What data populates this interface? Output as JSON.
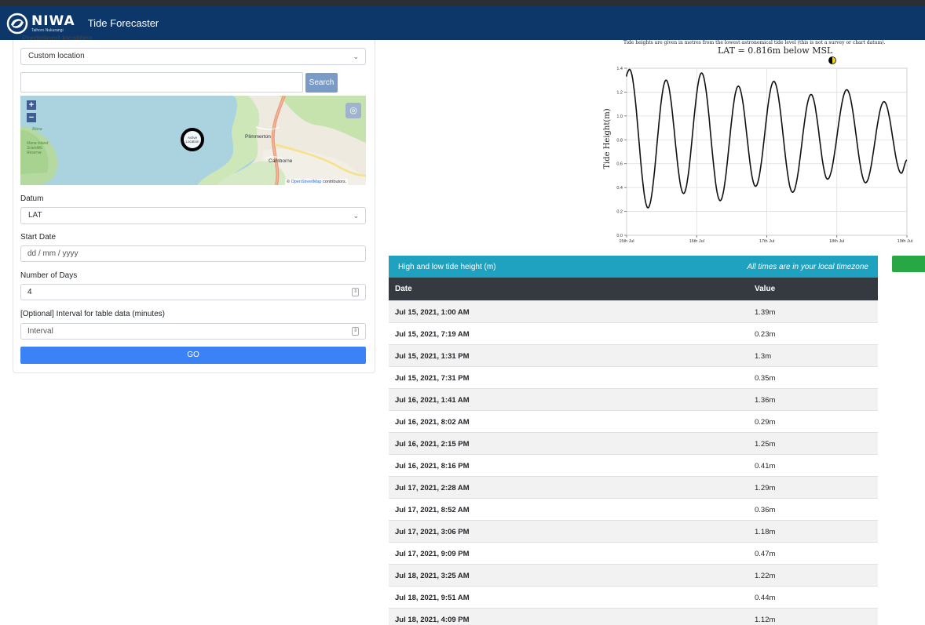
{
  "header": {
    "brand": "NIWA",
    "brand_tagline": "Taihoro Nukurangi",
    "app_title": "Tide Forecaster"
  },
  "form": {
    "predefined_label": "Predefined localities",
    "locality_selected": "Custom location",
    "search_value": "",
    "search_button": "Search",
    "map": {
      "zoom_in": "+",
      "zoom_out": "−",
      "marker_label": "Active location",
      "places": [
        "Mana Island Scientific Reserve",
        "Plimmerton",
        "Camborne",
        "Mana"
      ],
      "attribution_prefix": "© ",
      "attribution_link": "OpenStreetMap",
      "attribution_suffix": " contributors."
    },
    "datum_label": "Datum",
    "datum_selected": "LAT",
    "start_date_label": "Start Date",
    "start_date_placeholder": "dd / mm / yyyy",
    "days_label": "Number of Days",
    "days_value": "4",
    "interval_label": "[Optional] Interval for table data (minutes)",
    "interval_placeholder": "Interval",
    "go_button": "GO"
  },
  "chart_header": {
    "note": "Tide heights are given in metres from the lowest astronomical tide level (this is not a survey or chart datum).",
    "sub": "LAT = 0.816m below MSL"
  },
  "chart_data": {
    "type": "line",
    "title": "",
    "xlabel": "",
    "ylabel": "Tide Height(m)",
    "xlim": [
      0,
      4
    ],
    "ylim": [
      0,
      1.4
    ],
    "x_ticks": [
      {
        "pos": 0,
        "label": "15th Jul"
      },
      {
        "pos": 1,
        "label": "16th Jul"
      },
      {
        "pos": 2,
        "label": "17th Jul"
      },
      {
        "pos": 3,
        "label": "18th Jul"
      },
      {
        "pos": 4,
        "label": "19th Jul"
      }
    ],
    "y_ticks": [
      0.0,
      0.2,
      0.4,
      0.6,
      0.8,
      1.0,
      1.2,
      1.4
    ],
    "y_tick_labels": [
      "0.0",
      "0.2",
      "0.4",
      "0.6",
      "0.8",
      "1.0",
      "1.2",
      "1.4"
    ],
    "grid": true,
    "series": [
      {
        "x": [
          -0.02,
          0.042,
          0.305,
          0.563,
          0.813,
          1.07,
          1.335,
          1.594,
          1.84,
          2.101,
          2.369,
          2.632,
          2.868,
          3.142,
          3.41,
          3.673,
          3.92,
          4.0
        ],
        "y": [
          1.33,
          1.39,
          0.23,
          1.3,
          0.35,
          1.36,
          0.29,
          1.25,
          0.41,
          1.29,
          0.36,
          1.18,
          0.47,
          1.22,
          0.44,
          1.12,
          0.52,
          0.63
        ]
      }
    ],
    "moon_phase_icon": "first-quarter-moon-icon"
  },
  "table": {
    "title": "High and low tide height (m)",
    "note": "All times are in your local timezone",
    "columns": [
      "Date",
      "Value"
    ],
    "rows": [
      {
        "date": "Jul 15, 2021, 1:00 AM",
        "value": "1.39m"
      },
      {
        "date": "Jul 15, 2021, 7:19 AM",
        "value": "0.23m"
      },
      {
        "date": "Jul 15, 2021, 1:31 PM",
        "value": "1.3m"
      },
      {
        "date": "Jul 15, 2021, 7:31 PM",
        "value": "0.35m"
      },
      {
        "date": "Jul 16, 2021, 1:41 AM",
        "value": "1.36m"
      },
      {
        "date": "Jul 16, 2021, 8:02 AM",
        "value": "0.29m"
      },
      {
        "date": "Jul 16, 2021, 2:15 PM",
        "value": "1.25m"
      },
      {
        "date": "Jul 16, 2021, 8:16 PM",
        "value": "0.41m"
      },
      {
        "date": "Jul 17, 2021, 2:28 AM",
        "value": "1.29m"
      },
      {
        "date": "Jul 17, 2021, 8:52 AM",
        "value": "0.36m"
      },
      {
        "date": "Jul 17, 2021, 3:06 PM",
        "value": "1.18m"
      },
      {
        "date": "Jul 17, 2021, 9:09 PM",
        "value": "0.47m"
      },
      {
        "date": "Jul 18, 2021, 3:25 AM",
        "value": "1.22m"
      },
      {
        "date": "Jul 18, 2021, 9:51 AM",
        "value": "0.44m"
      },
      {
        "date": "Jul 18, 2021, 4:09 PM",
        "value": "1.12m"
      }
    ]
  },
  "colors": {
    "navbar": "#0d3768",
    "table_header": "#1fa2c0",
    "go_button": "#3b82f6",
    "search_button": "#7a9bc6",
    "green_button": "#28a745"
  }
}
